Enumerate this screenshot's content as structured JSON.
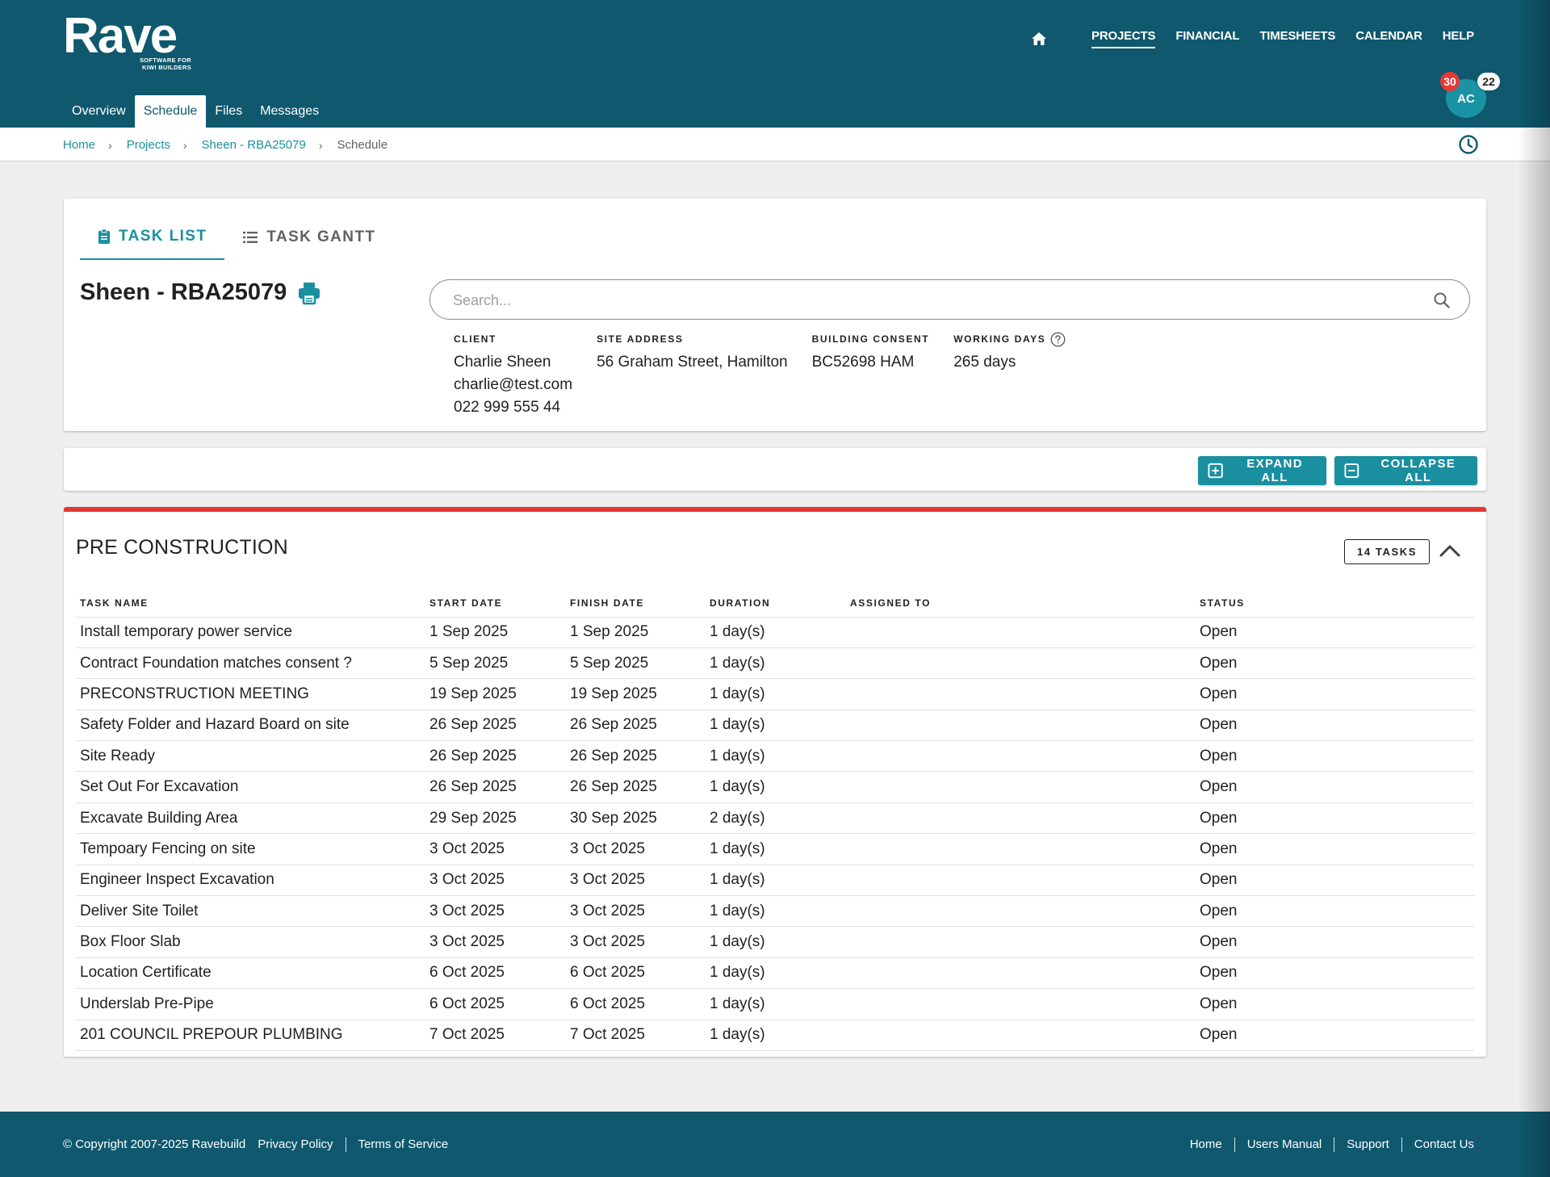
{
  "brand": {
    "name": "Rave",
    "tagline_line1": "SOFTWARE FOR",
    "tagline_line2": "KIWI BUILDERS"
  },
  "main_nav": {
    "items": [
      {
        "label": "PROJECTS",
        "active": true
      },
      {
        "label": "FINANCIAL",
        "active": false
      },
      {
        "label": "TIMESHEETS",
        "active": false
      },
      {
        "label": "CALENDAR",
        "active": false
      },
      {
        "label": "HELP",
        "active": false
      }
    ]
  },
  "sub_tabs": [
    {
      "label": "Overview",
      "active": false
    },
    {
      "label": "Schedule",
      "active": true
    },
    {
      "label": "Files",
      "active": false
    },
    {
      "label": "Messages",
      "active": false
    }
  ],
  "user": {
    "initials": "AC",
    "badge_red": "30",
    "badge_white": "22"
  },
  "breadcrumb": [
    {
      "label": "Home"
    },
    {
      "label": "Projects"
    },
    {
      "label": "Sheen - RBA25079"
    },
    {
      "label": "Schedule"
    }
  ],
  "view_tabs": [
    {
      "label": "TASK LIST",
      "active": true,
      "icon": "clipboard-icon"
    },
    {
      "label": "TASK GANTT",
      "active": false,
      "icon": "list-icon"
    }
  ],
  "project": {
    "title": "Sheen - RBA25079",
    "search_placeholder": "Search...",
    "client_label": "CLIENT",
    "client_name": "Charlie Sheen",
    "client_email": "charlie@test.com",
    "client_phone": "022 999 555 44",
    "site_address_label": "SITE ADDRESS",
    "site_address": "56 Graham Street, Hamilton",
    "building_consent_label": "BUILDING CONSENT",
    "building_consent": "BC52698 HAM",
    "working_days_label": "WORKING DAYS",
    "working_days": "265 days"
  },
  "actions": {
    "expand_all": "EXPAND ALL",
    "collapse_all": "COLLAPSE ALL"
  },
  "stage": {
    "title": "PRE CONSTRUCTION",
    "task_count": "14 TASKS",
    "accent_color": "#e53935",
    "columns": {
      "task_name": "TASK NAME",
      "start_date": "START DATE",
      "finish_date": "FINISH DATE",
      "duration": "DURATION",
      "assigned_to": "ASSIGNED TO",
      "status": "STATUS"
    },
    "tasks": [
      {
        "name": "Install temporary power service",
        "start": "1 Sep 2025",
        "finish": "1 Sep 2025",
        "duration": "1 day(s)",
        "assigned": "",
        "status": "Open"
      },
      {
        "name": "Contract Foundation matches consent ?",
        "start": "5 Sep 2025",
        "finish": "5 Sep 2025",
        "duration": "1 day(s)",
        "assigned": "",
        "status": "Open"
      },
      {
        "name": "PRECONSTRUCTION MEETING",
        "start": "19 Sep 2025",
        "finish": "19 Sep 2025",
        "duration": "1 day(s)",
        "assigned": "",
        "status": "Open"
      },
      {
        "name": "Safety Folder and Hazard Board on site",
        "start": "26 Sep 2025",
        "finish": "26 Sep 2025",
        "duration": "1 day(s)",
        "assigned": "",
        "status": "Open"
      },
      {
        "name": "Site Ready",
        "start": "26 Sep 2025",
        "finish": "26 Sep 2025",
        "duration": "1 day(s)",
        "assigned": "",
        "status": "Open"
      },
      {
        "name": "Set Out For Excavation",
        "start": "26 Sep 2025",
        "finish": "26 Sep 2025",
        "duration": "1 day(s)",
        "assigned": "",
        "status": "Open"
      },
      {
        "name": "Excavate Building Area",
        "start": "29 Sep 2025",
        "finish": "30 Sep 2025",
        "duration": "2 day(s)",
        "assigned": "",
        "status": "Open"
      },
      {
        "name": "Tempoary Fencing on site",
        "start": "3 Oct 2025",
        "finish": "3 Oct 2025",
        "duration": "1 day(s)",
        "assigned": "",
        "status": "Open"
      },
      {
        "name": "Engineer Inspect Excavation",
        "start": "3 Oct 2025",
        "finish": "3 Oct 2025",
        "duration": "1 day(s)",
        "assigned": "",
        "status": "Open"
      },
      {
        "name": "Deliver Site Toilet",
        "start": "3 Oct 2025",
        "finish": "3 Oct 2025",
        "duration": "1 day(s)",
        "assigned": "",
        "status": "Open"
      },
      {
        "name": "Box Floor Slab",
        "start": "3 Oct 2025",
        "finish": "3 Oct 2025",
        "duration": "1 day(s)",
        "assigned": "",
        "status": "Open"
      },
      {
        "name": "Location Certificate",
        "start": "6 Oct 2025",
        "finish": "6 Oct 2025",
        "duration": "1 day(s)",
        "assigned": "",
        "status": "Open"
      },
      {
        "name": "Underslab Pre-Pipe",
        "start": "6 Oct 2025",
        "finish": "6 Oct 2025",
        "duration": "1 day(s)",
        "assigned": "",
        "status": "Open"
      },
      {
        "name": "201 COUNCIL PREPOUR PLUMBING",
        "start": "7 Oct 2025",
        "finish": "7 Oct 2025",
        "duration": "1 day(s)",
        "assigned": "",
        "status": "Open"
      }
    ]
  },
  "footer": {
    "copyright": "© Copyright 2007-2025 Ravebuild",
    "left_links": [
      {
        "label": "Privacy Policy"
      },
      {
        "label": "Terms of Service"
      }
    ],
    "right_links": [
      {
        "label": "Home"
      },
      {
        "label": "Users Manual"
      },
      {
        "label": "Support"
      },
      {
        "label": "Contact Us"
      }
    ]
  },
  "colors": {
    "header_bg": "#0f586e",
    "accent": "#1a8fa0",
    "danger": "#e53935"
  }
}
